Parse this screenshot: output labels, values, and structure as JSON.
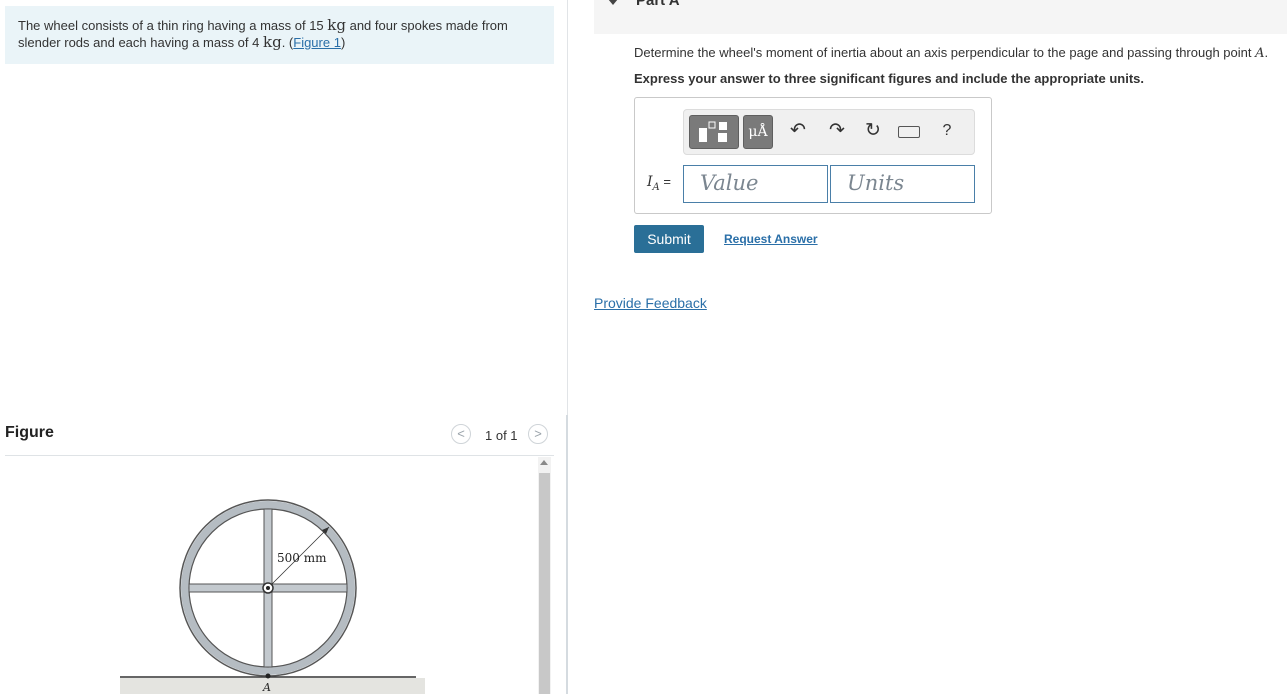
{
  "problem": {
    "text_1": "The wheel consists of a thin ring having a mass of 15 ",
    "unit_1": "kg",
    "text_2": " and four spokes made from slender rods and each having a mass of 4 ",
    "unit_2": "kg",
    "text_3": ". (",
    "figure_link": "Figure 1",
    "text_4": ")"
  },
  "figure": {
    "title": "Figure",
    "page_count": "1 of 1",
    "prev_glyph": "<",
    "next_glyph": ">",
    "dimension_label": "500 mm",
    "point_label": "A"
  },
  "part": {
    "title": "Part A",
    "question_text": "Determine the wheel's moment of inertia about an axis perpendicular to the page and passing through point ",
    "question_point": "A",
    "question_end": ".",
    "instruction": "Express your answer to three significant figures and include the appropriate units."
  },
  "answer": {
    "label_symbol": "I",
    "label_sub": "A",
    "label_eq": " =",
    "value_placeholder": "Value",
    "units_placeholder": "Units"
  },
  "toolbar": {
    "units_label": "μÅ",
    "undo_icon": "↶",
    "redo_icon": "↷",
    "reset_icon": "↻",
    "help_label": "?"
  },
  "actions": {
    "submit": "Submit",
    "request_answer": "Request Answer",
    "provide_feedback": "Provide Feedback"
  },
  "colors": {
    "link": "#2a6fa8",
    "submit_bg": "#2a6f97",
    "problem_bg": "#eaf4f8"
  }
}
